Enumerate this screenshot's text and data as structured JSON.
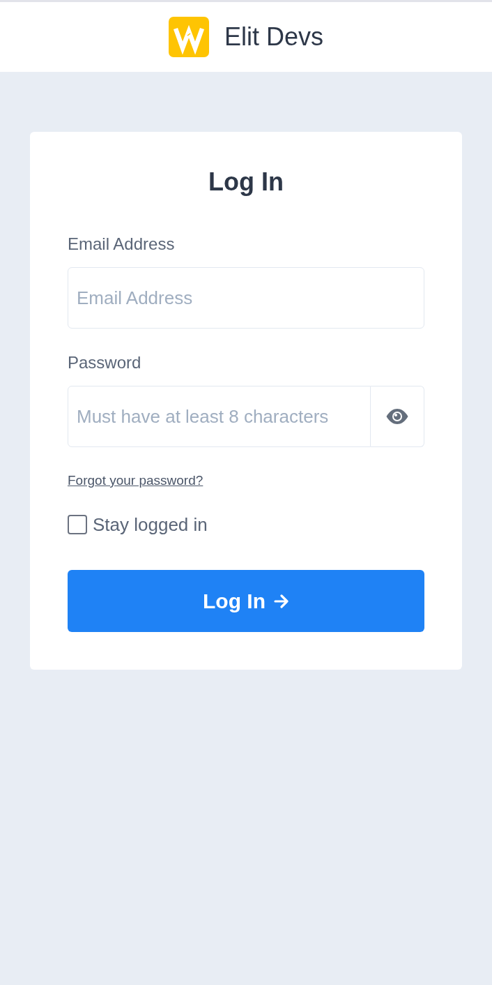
{
  "header": {
    "brand": "Elit Devs"
  },
  "form": {
    "title": "Log In",
    "fields": [
      {
        "kind": "text",
        "label": "Email Address",
        "placeholder": "Email Address"
      },
      {
        "kind": "password",
        "label": "Password",
        "placeholder": "Must have at least 8 characters"
      }
    ],
    "forgot_link": "Forgot your password?",
    "stay_logged_in": {
      "label": "Stay logged in",
      "checked": false
    },
    "submit": {
      "label": "Log In"
    }
  }
}
